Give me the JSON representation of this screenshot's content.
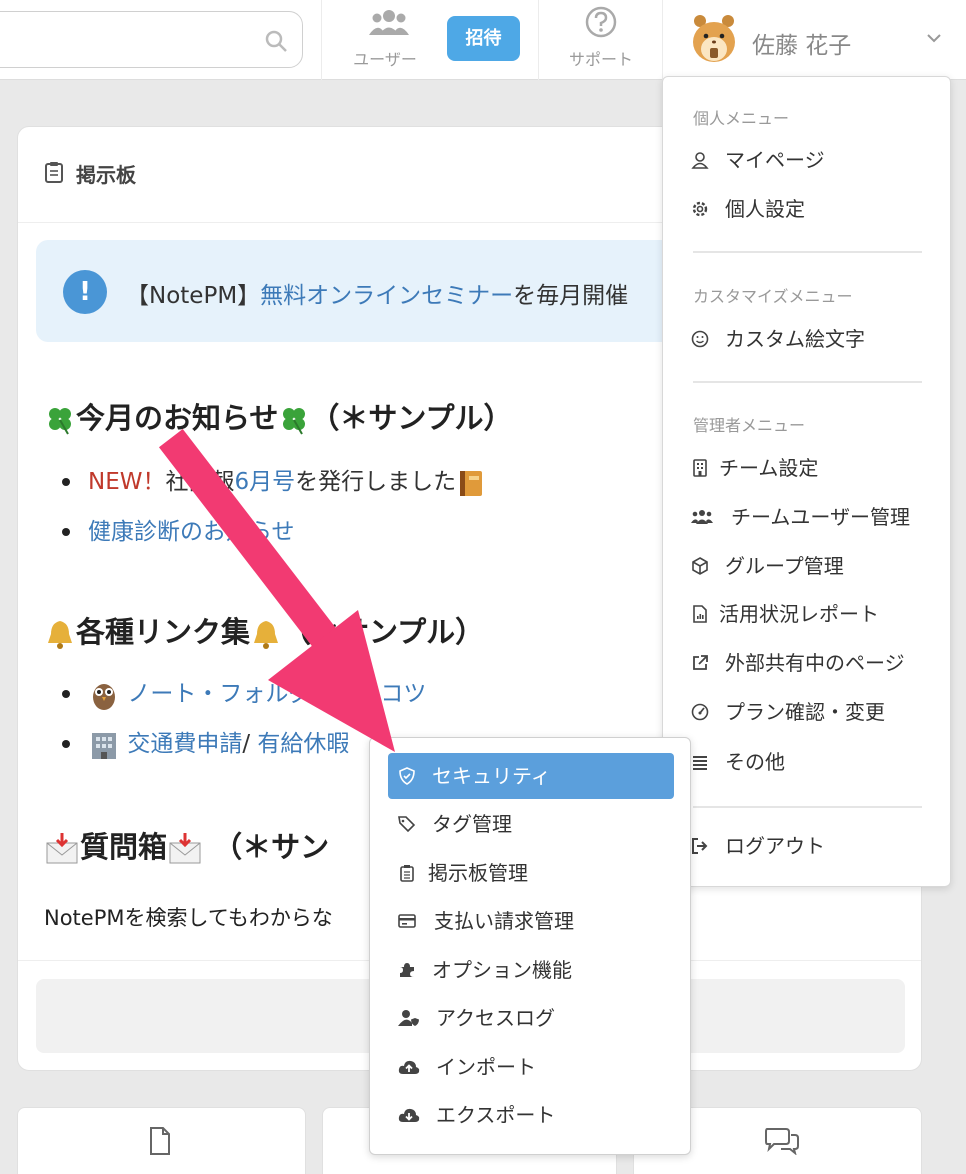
{
  "topbar": {
    "users_label": "ユーザー",
    "invite_label": "招待",
    "support_label": "サポート",
    "user_name": "佐藤 花子"
  },
  "board": {
    "title": "掲示板",
    "notice": {
      "prefix": "【NotePM】",
      "link": "無料オンラインセミナー",
      "suffix": "を毎月開催"
    },
    "section1": {
      "title": "今月のお知らせ",
      "suffix": "（＊サンプル）",
      "items": [
        {
          "new": "NEW！",
          "pre": "社内報",
          "link": "6月号",
          "post": "を発行しました"
        },
        {
          "link": "健康診断のお知らせ"
        }
      ]
    },
    "section2": {
      "title": "各種リンク集",
      "suffix": "（＊サンプル）",
      "items": [
        {
          "link": "ノート・フォルダ整理のコツ"
        },
        {
          "link_a": "交通費申請",
          "sep": "/ ",
          "link_b": "有給休暇"
        }
      ]
    },
    "section3": {
      "title": "質問箱",
      "suffix": "（＊サン"
    },
    "paragraph": "NotePMを検索してもわからな"
  },
  "user_menu": {
    "personal_header": "個人メニュー",
    "mypage": "マイページ",
    "personal_settings": "個人設定",
    "custom_header": "カスタマイズメニュー",
    "custom_emoji": "カスタム絵文字",
    "admin_header": "管理者メニュー",
    "team_settings": "チーム設定",
    "team_users": "チームユーザー管理",
    "groups": "グループ管理",
    "usage_report": "活用状況レポート",
    "external_pages": "外部共有中のページ",
    "plan": "プラン確認・変更",
    "others": "その他",
    "logout": "ログアウト"
  },
  "submenu": {
    "items": [
      {
        "label": "セキュリティ",
        "icon": "shield-icon",
        "active": true
      },
      {
        "label": "タグ管理",
        "icon": "tags-icon"
      },
      {
        "label": "掲示板管理",
        "icon": "clipboard-icon"
      },
      {
        "label": "支払い請求管理",
        "icon": "credit-card-icon"
      },
      {
        "label": "オプション機能",
        "icon": "puzzle-icon"
      },
      {
        "label": "アクセスログ",
        "icon": "user-shield-icon"
      },
      {
        "label": "インポート",
        "icon": "cloud-upload-icon"
      },
      {
        "label": "エクスポート",
        "icon": "cloud-download-icon"
      }
    ]
  },
  "colors": {
    "accent": "#4ea8e6",
    "active_item": "#5b9fdc",
    "link": "#3d7ab8",
    "arrow": "#f23a72"
  }
}
